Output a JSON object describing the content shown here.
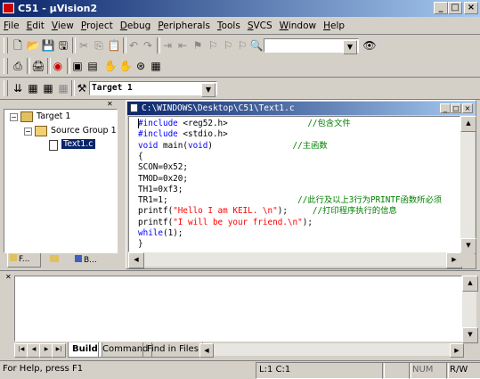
{
  "window": {
    "title": "C51 - μVision2"
  },
  "menu": [
    {
      "label": "File",
      "key": "F",
      "rest": "ile"
    },
    {
      "label": "Edit",
      "key": "E",
      "rest": "dit"
    },
    {
      "label": "View",
      "key": "V",
      "rest": "iew"
    },
    {
      "label": "Project",
      "key": "P",
      "rest": "roject"
    },
    {
      "label": "Debug",
      "key": "D",
      "rest": "ebug"
    },
    {
      "label": "Peripherals",
      "key": "P",
      "rest": "eripherals"
    },
    {
      "label": "Tools",
      "key": "T",
      "rest": "ools"
    },
    {
      "label": "SVCS",
      "key": "S",
      "rest": "VCS"
    },
    {
      "label": "Window",
      "key": "W",
      "rest": "indow"
    },
    {
      "label": "Help",
      "key": "H",
      "rest": "elp"
    }
  ],
  "toolbar": {
    "find_combo_value": "",
    "target_combo_value": "Target 1"
  },
  "project": {
    "target": "Target 1",
    "group": "Source Group 1",
    "file": "Text1.c",
    "tabs": [
      "F...",
      "B..."
    ]
  },
  "editor": {
    "title": "C:\\WINDOWS\\Desktop\\C51\\Text1.c",
    "lines": [
      {
        "parts": [
          {
            "t": "#include",
            "c": "kw"
          },
          {
            "t": " <reg52.h>",
            "c": ""
          },
          {
            "t": "                //包含文件",
            "c": "cmt"
          }
        ]
      },
      {
        "parts": [
          {
            "t": "#include",
            "c": "kw"
          },
          {
            "t": " <stdio.h>",
            "c": ""
          }
        ]
      },
      {
        "parts": [
          {
            "t": "void",
            "c": "kw"
          },
          {
            "t": " main(",
            "c": ""
          },
          {
            "t": "void",
            "c": "kw"
          },
          {
            "t": ")",
            "c": ""
          },
          {
            "t": "                //主函数",
            "c": "cmt"
          }
        ]
      },
      {
        "parts": [
          {
            "t": "{",
            "c": ""
          }
        ]
      },
      {
        "parts": [
          {
            "t": "SCON=0x52;",
            "c": ""
          }
        ]
      },
      {
        "parts": [
          {
            "t": "TMOD=0x20;",
            "c": ""
          }
        ]
      },
      {
        "parts": [
          {
            "t": "TH1=0xf3;",
            "c": ""
          }
        ]
      },
      {
        "parts": [
          {
            "t": "TR1=1;",
            "c": ""
          },
          {
            "t": "                          //此行及以上3行为PRINTF函数所必须",
            "c": "cmt"
          }
        ]
      },
      {
        "parts": [
          {
            "t": "printf(",
            "c": ""
          },
          {
            "t": "\"Hello I am KEIL. \\n\"",
            "c": "str"
          },
          {
            "t": ");",
            "c": ""
          },
          {
            "t": "     //打印程序执行的信息",
            "c": "cmt"
          }
        ]
      },
      {
        "parts": [
          {
            "t": "printf(",
            "c": ""
          },
          {
            "t": "\"I will be your friend.\\n\"",
            "c": "str"
          },
          {
            "t": ");",
            "c": ""
          }
        ]
      },
      {
        "parts": [
          {
            "t": "while",
            "c": "kw"
          },
          {
            "t": "(1);",
            "c": ""
          }
        ]
      },
      {
        "parts": [
          {
            "t": "}",
            "c": ""
          }
        ]
      }
    ]
  },
  "output": {
    "tabs": [
      "Build",
      "Command",
      "Find in Files"
    ]
  },
  "status": {
    "help": "For Help, press F1",
    "position": "L:1 C:1",
    "mode1": "",
    "mode2": "NUM",
    "mode3": "R/W"
  }
}
